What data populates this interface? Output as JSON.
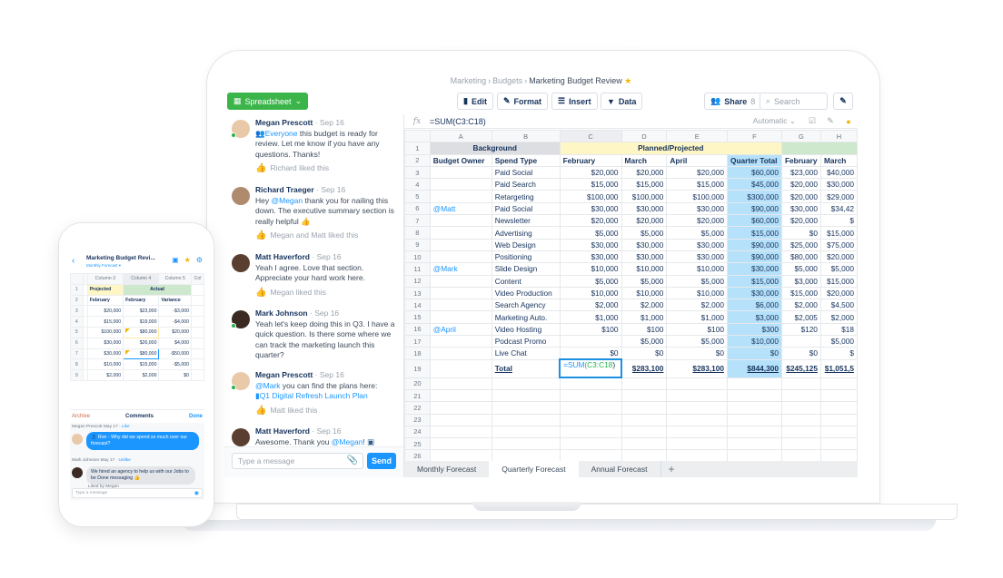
{
  "app": {
    "breadcrumb": [
      "Marketing",
      "Budgets"
    ],
    "title": "Marketing Budget Review",
    "favorite": true
  },
  "toolbar": {
    "spreadsheet_label": "Spreadsheet",
    "edit_label": "Edit",
    "format_label": "Format",
    "insert_label": "Insert",
    "data_label": "Data",
    "share_label": "Share",
    "share_count": "8",
    "search_placeholder": "Search"
  },
  "chat": {
    "messages": [
      {
        "author": "Megan Prescott",
        "date": "Sep 16",
        "online": true,
        "mention": "Everyone",
        "text": " this budget is ready for review. Let me know if you have any questions. Thanks!",
        "liked": "Richard liked this"
      },
      {
        "author": "Richard Traeger",
        "date": "Sep 16",
        "online": false,
        "pre": "Hey ",
        "mention": "@Megan",
        "text": " thank you for nailing this down. The executive summary section is really helpful 👍",
        "liked": "Megan and Matt liked this"
      },
      {
        "author": "Matt Haverford",
        "date": "Sep 16",
        "online": false,
        "text": "Yeah I agree. Love that section. Appreciate your hard work here.",
        "liked": "Megan liked this"
      },
      {
        "author": "Mark Johnson",
        "date": "Sep 16",
        "online": true,
        "text": "Yeah let's keep doing this in Q3. I have a quick question. Is there some where we can track the marketing launch this quarter?",
        "liked": ""
      },
      {
        "author": "Megan Prescott",
        "date": "Sep 16",
        "online": true,
        "mention": "@Mark",
        "text": " you can find the plans here:",
        "link": "Q1 Digital Refresh Launch Plan",
        "liked": "Matt liked this"
      },
      {
        "author": "Matt Haverford",
        "date": "Sep 16",
        "online": false,
        "pre": "Awesome. Thank you ",
        "mention": "@Megan",
        "text": "!",
        "liked": ""
      }
    ],
    "input_placeholder": "Type a message",
    "send_label": "Send"
  },
  "sheet": {
    "formula": "=SUM(C3:C18)",
    "calc_mode": "Automatic",
    "columns": [
      "A",
      "B",
      "C",
      "D",
      "E",
      "F",
      "G",
      "H"
    ],
    "row1": {
      "background": "Background",
      "planned": "Planned/Projected"
    },
    "headers": [
      "Budget Owner",
      "Spend Type",
      "February",
      "March",
      "April",
      "Quarter Total",
      "February",
      "March"
    ],
    "rows": [
      {
        "n": "3",
        "owner": "",
        "type": "Paid Social",
        "c": "$20,000",
        "d": "$20,000",
        "e": "$20,000",
        "f": "$60,000",
        "g": "$23,000",
        "h": "$40,000"
      },
      {
        "n": "4",
        "owner": "",
        "type": "Paid Search",
        "c": "$15,000",
        "d": "$15,000",
        "e": "$15,000",
        "f": "$45,000",
        "g": "$20,000",
        "h": "$30,000"
      },
      {
        "n": "5",
        "owner": "",
        "type": "Retargeting",
        "c": "$100,000",
        "d": "$100,000",
        "e": "$100,000",
        "f": "$300,000",
        "g": "$20,000",
        "h": "$29,000"
      },
      {
        "n": "6",
        "owner": "@Matt",
        "type": "Paid Social",
        "c": "$30,000",
        "d": "$30,000",
        "e": "$30,000",
        "f": "$90,000",
        "g": "$30,000",
        "h": "$34,42"
      },
      {
        "n": "7",
        "owner": "",
        "type": "Newsletter",
        "c": "$20,000",
        "d": "$20,000",
        "e": "$20,000",
        "f": "$60,000",
        "g": "$20,000",
        "h": "$"
      },
      {
        "n": "8",
        "owner": "",
        "type": "Advertising",
        "c": "$5,000",
        "d": "$5,000",
        "e": "$5,000",
        "f": "$15,000",
        "g": "$0",
        "h": "$15,000"
      },
      {
        "n": "9",
        "owner": "",
        "type": "Web Design",
        "c": "$30,000",
        "d": "$30,000",
        "e": "$30,000",
        "f": "$90,000",
        "g": "$25,000",
        "h": "$75,000"
      },
      {
        "n": "10",
        "owner": "",
        "type": "Positioning",
        "c": "$30,000",
        "d": "$30,000",
        "e": "$30,000",
        "f": "$90,000",
        "g": "$80,000",
        "h": "$20,000"
      },
      {
        "n": "11",
        "owner": "@Mark",
        "type": "Slide Design",
        "c": "$10,000",
        "d": "$10,000",
        "e": "$10,000",
        "f": "$30,000",
        "g": "$5,000",
        "h": "$5,000"
      },
      {
        "n": "12",
        "owner": "",
        "type": "Content",
        "c": "$5,000",
        "d": "$5,000",
        "e": "$5,000",
        "f": "$15,000",
        "g": "$3,000",
        "h": "$15,000"
      },
      {
        "n": "13",
        "owner": "",
        "type": "Video Production",
        "c": "$10,000",
        "d": "$10,000",
        "e": "$10,000",
        "f": "$30,000",
        "g": "$15,000",
        "h": "$20,000"
      },
      {
        "n": "14",
        "owner": "",
        "type": "Search Agency",
        "c": "$2,000",
        "d": "$2,000",
        "e": "$2,000",
        "f": "$6,000",
        "g": "$2,000",
        "h": "$4,500"
      },
      {
        "n": "15",
        "owner": "",
        "type": "Marketing Auto.",
        "c": "$1,000",
        "d": "$1,000",
        "e": "$1,000",
        "f": "$3,000",
        "g": "$2,005",
        "h": "$2,000"
      },
      {
        "n": "16",
        "owner": "@April",
        "type": "Video Hosting",
        "c": "$100",
        "d": "$100",
        "e": "$100",
        "f": "$300",
        "g": "$120",
        "h": "$18"
      },
      {
        "n": "17",
        "owner": "",
        "type": "Podcast Promo",
        "c": "",
        "d": "$5,000",
        "e": "$5,000",
        "f": "$10,000",
        "g": "",
        "h": "$5,000"
      },
      {
        "n": "18",
        "owner": "",
        "type": "Live Chat",
        "c": "$0",
        "d": "$0",
        "e": "$0",
        "f": "$0",
        "g": "$0",
        "h": "$"
      }
    ],
    "total": {
      "n": "19",
      "label": "Total",
      "c_fn": "=SUM",
      "c_range": "(C3:C18",
      "c_close": ")",
      "d": "$283,100",
      "e": "$283,100",
      "f": "$844,300",
      "g": "$245,125",
      "h": "$1,051,5"
    },
    "empty_rows": [
      "20",
      "21",
      "22",
      "23",
      "24",
      "25",
      "26"
    ],
    "tabs": [
      "Monthly Forecast",
      "Quarterly Forecast",
      "Annual Forecast"
    ],
    "active_tab": 1
  },
  "phone": {
    "title": "Marketing Budget Revi...",
    "subtitle": "Monthly Forecast ▾",
    "columns": [
      "Column 3",
      "Column 4",
      "Column 5",
      "Col"
    ],
    "row1": {
      "projected": "Projected",
      "actual": "Actual"
    },
    "headers": [
      "February",
      "February",
      "Variance"
    ],
    "rows": [
      {
        "n": "3",
        "a": "$20,000",
        "b": "$23,000",
        "c": "-$3,000"
      },
      {
        "n": "4",
        "a": "$15,000",
        "b": "$19,000",
        "c": "-$4,000"
      },
      {
        "n": "5",
        "a": "$100,000",
        "b": "$80,000",
        "c": "$20,000"
      },
      {
        "n": "6",
        "a": "$30,000",
        "b": "$26,000",
        "c": "$4,000"
      },
      {
        "n": "7",
        "a": "$30,000",
        "b": "$80,000",
        "c": "-$50,000"
      },
      {
        "n": "8",
        "a": "$10,000",
        "b": "$15,000",
        "c": "-$5,000"
      },
      {
        "n": "9",
        "a": "$2,000",
        "b": "$2,000",
        "c": "$0"
      }
    ],
    "archive_label": "Archive",
    "comments_label": "Comments",
    "done_label": "Done",
    "comment1": {
      "meta": "Megan Prescott May 17 · ",
      "action": "Like",
      "mention": "Ron",
      "text": " - Why did we spend so much over our forecast?"
    },
    "comment2": {
      "meta": "Mark Johnson May 17 · ",
      "action": "Unlike",
      "text": "We hired an agency to help us with our Jobs to be Done messaging 👍",
      "liked": "Liked by Megan"
    },
    "input_placeholder": "Type a message"
  }
}
